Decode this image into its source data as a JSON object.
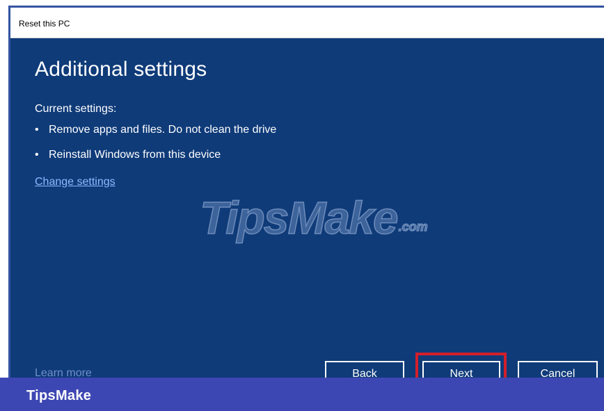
{
  "window": {
    "title": "Reset this PC"
  },
  "main": {
    "heading": "Additional settings",
    "current_label": "Current settings:",
    "bullets": [
      "Remove apps and files. Do not clean the drive",
      "Reinstall Windows from this device"
    ],
    "change_link": "Change settings",
    "learn_more": "Learn more"
  },
  "watermark": {
    "main": "TipsMake",
    "suffix": ".com"
  },
  "buttons": {
    "back": "Back",
    "next": "Next",
    "cancel": "Cancel"
  },
  "footer": {
    "brand": "TipsMake"
  },
  "colors": {
    "background": "#0f3b79",
    "highlight": "#d21f2b",
    "footer": "#3d47b3",
    "link": "#8fb8ff"
  }
}
